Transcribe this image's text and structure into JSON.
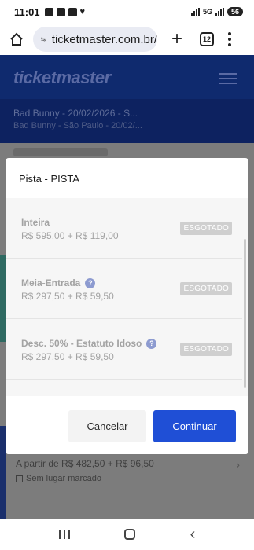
{
  "status_bar": {
    "time": "11:01",
    "network": "5G",
    "battery": "56"
  },
  "browser": {
    "url": "ticketmaster.com.br/",
    "tab_count": "12"
  },
  "site": {
    "logo": "ticketmaster",
    "event_title": "Bad Bunny - 20/02/2026 - S...",
    "event_subtitle": "Bad Bunny - São Paulo - 20/02/..."
  },
  "background_list": {
    "price": "A partir de R$ 482,50 + R$ 96,50",
    "seating": "Sem lugar marcado"
  },
  "modal": {
    "title": "Pista - PISTA",
    "tickets": [
      {
        "name": "Inteira",
        "price": "R$ 595,00 + R$ 119,00",
        "status": "ESGOTADO",
        "info_icon": false
      },
      {
        "name": "Meia-Entrada",
        "price": "R$ 297,50 + R$ 59,50",
        "status": "ESGOTADO",
        "info_icon": true
      },
      {
        "name": "Desc. 50% - Estatuto Idoso",
        "price": "R$ 297,50 + R$ 59,50",
        "status": "ESGOTADO",
        "info_icon": true
      }
    ],
    "info_glyph": "?",
    "cancel_label": "Cancelar",
    "continue_label": "Continuar"
  },
  "colors": {
    "brand_header": "#0f2a6e",
    "primary_button": "#1f4fd6",
    "sold_out_badge": "#cfcfcf"
  }
}
